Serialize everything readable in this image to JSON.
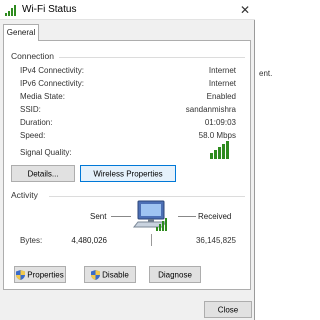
{
  "window": {
    "title": "Wi-Fi Status",
    "close_glyph": "✕"
  },
  "tabs": [
    {
      "label": "General"
    }
  ],
  "connection": {
    "heading": "Connection",
    "rows": [
      {
        "label": "IPv4 Connectivity:",
        "value": "Internet"
      },
      {
        "label": "IPv6 Connectivity:",
        "value": "Internet"
      },
      {
        "label": "Media State:",
        "value": "Enabled"
      },
      {
        "label": "SSID:",
        "value": "sandanmishra"
      },
      {
        "label": "Duration:",
        "value": "01:09:03"
      },
      {
        "label": "Speed:",
        "value": "58.0 Mbps"
      }
    ],
    "signal_label": "Signal Quality:",
    "signal_bars_lit": 5,
    "signal_bars_total": 5,
    "details_button": "Details...",
    "wireless_button": "Wireless Properties"
  },
  "activity": {
    "heading": "Activity",
    "sent_label": "Sent",
    "received_label": "Received",
    "bytes_label": "Bytes:",
    "bytes_sent": "4,480,026",
    "bytes_received": "36,145,825"
  },
  "actions": {
    "properties": "Properties",
    "disable": "Disable",
    "diagnose": "Diagnose"
  },
  "footer": {
    "close": "Close"
  },
  "background": {
    "fragment": "ent."
  },
  "colors": {
    "signal": "#2e8b1e",
    "focus": "#0078d7"
  },
  "icons": {
    "title": "wifi-signal-icon",
    "activity": "network-computer-icon",
    "admin": "uac-shield-icon"
  }
}
